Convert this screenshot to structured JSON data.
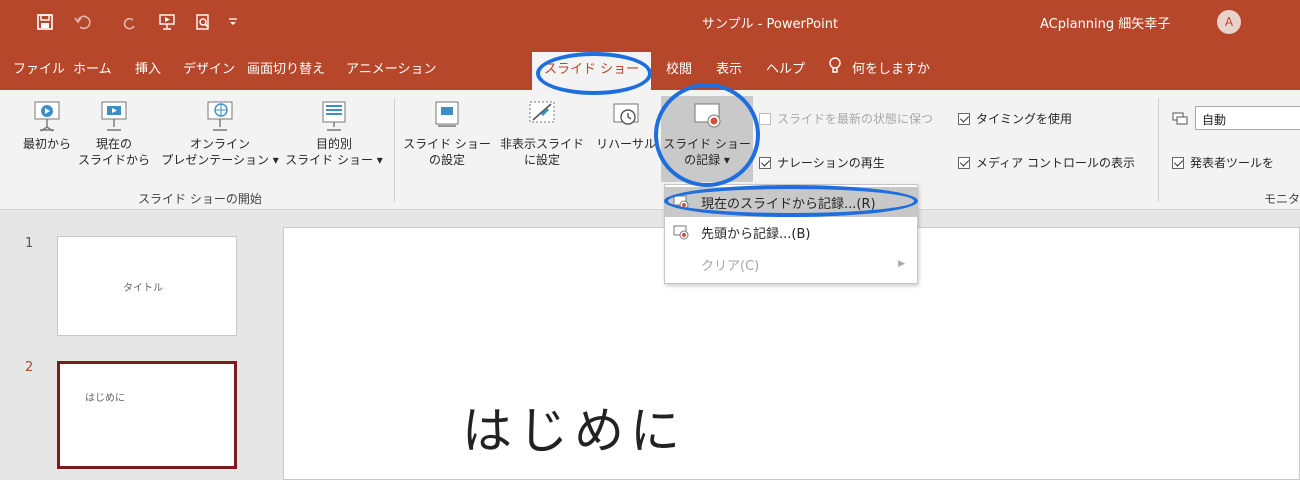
{
  "titlebar": {
    "app_title": "サンプル - PowerPoint",
    "user_name": "ACplanning 細矢幸子",
    "avatar_initial": "A"
  },
  "tabs": [
    {
      "label": "ファイル"
    },
    {
      "label": "ホーム"
    },
    {
      "label": "挿入"
    },
    {
      "label": "デザイン"
    },
    {
      "label": "画面切り替え"
    },
    {
      "label": "アニメーション"
    },
    {
      "label": "スライド ショー",
      "active": true
    },
    {
      "label": "校閲"
    },
    {
      "label": "表示"
    },
    {
      "label": "ヘルプ"
    }
  ],
  "tell_me": "何をしますか",
  "ribbon": {
    "start_group": {
      "label": "スライド ショーの開始",
      "btn_from_beginning": "最初から",
      "btn_from_current_1": "現在の",
      "btn_from_current_2": "スライドから",
      "btn_online_1": "オンライン",
      "btn_online_2": "プレゼンテーション",
      "btn_custom_1": "目的別",
      "btn_custom_2": "スライド ショー"
    },
    "setup_group": {
      "btn_setup_1": "スライド ショー",
      "btn_setup_2": "の設定",
      "btn_hide_1": "非表示スライド",
      "btn_hide_2": "に設定",
      "btn_rehearse": "リハーサル",
      "btn_record_1": "スライド ショー",
      "btn_record_2": "の記録",
      "chk_keep_updated": "スライドを最新の状態に保つ",
      "chk_narration": "ナレーションの再生",
      "chk_timings": "タイミングを使用",
      "chk_media_controls": "メディア コントロールの表示"
    },
    "monitor_group": {
      "monitor_value": "自動",
      "chk_presenter_view": "発表者ツールを",
      "label": "モニタ"
    }
  },
  "dropdown": {
    "items": [
      {
        "label": "現在のスライドから記録...(R)"
      },
      {
        "label": "先頭から記録...(B)"
      },
      {
        "label": "クリア(C)"
      }
    ]
  },
  "slides": [
    {
      "number": "1",
      "text": "タイトル"
    },
    {
      "number": "2",
      "text": "はじめに"
    }
  ],
  "main_slide": {
    "heading": "はじめに"
  },
  "colors": {
    "accent": "#b7472a",
    "annotation": "#1e6ee0"
  }
}
